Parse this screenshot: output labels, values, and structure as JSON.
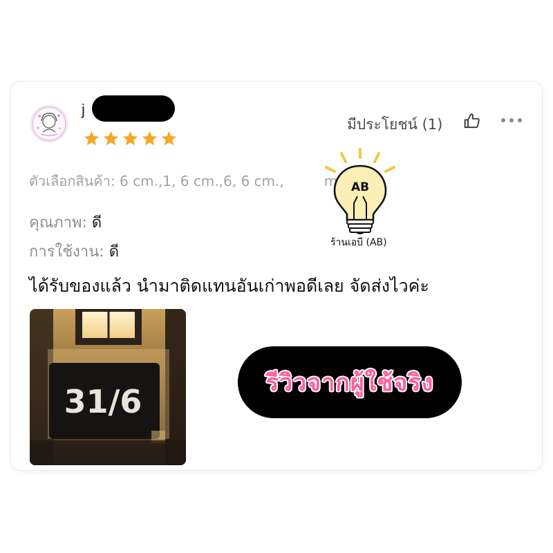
{
  "review": {
    "username": "j",
    "rating": 5,
    "helpful_label": "มีประโยชน์ (1)",
    "variant_text": "ตัวเลือกสินค้า: 6 cm.,1, 6 cm.,6, 6 cm.,",
    "variant_tail": "m.,/",
    "quality_label": "คุณภาพ:",
    "quality_value": "ดี",
    "usage_label": "การใช้งาน:",
    "usage_value": "ดี",
    "comment": "ได้รับของแล้ว นำมาติดแทนอันเก่าพอดีเลย จัดส่งไวค่ะ",
    "photo_text": "31/6"
  },
  "overlay": {
    "logo_text": "AB",
    "shop_label": "ร้านเอบี (AB)",
    "badge_text": "รีวิวจากผู้ใช้จริง"
  },
  "icons": {
    "thumb": "thumb-up-icon",
    "more": "more-horizontal-icon",
    "star": "star-icon",
    "avatar": "avatar-illustration"
  },
  "colors": {
    "star": "#F5A623",
    "badge_bg": "#000000",
    "badge_text": "#FF5FA0",
    "bulb_rays": "#F5C542"
  }
}
